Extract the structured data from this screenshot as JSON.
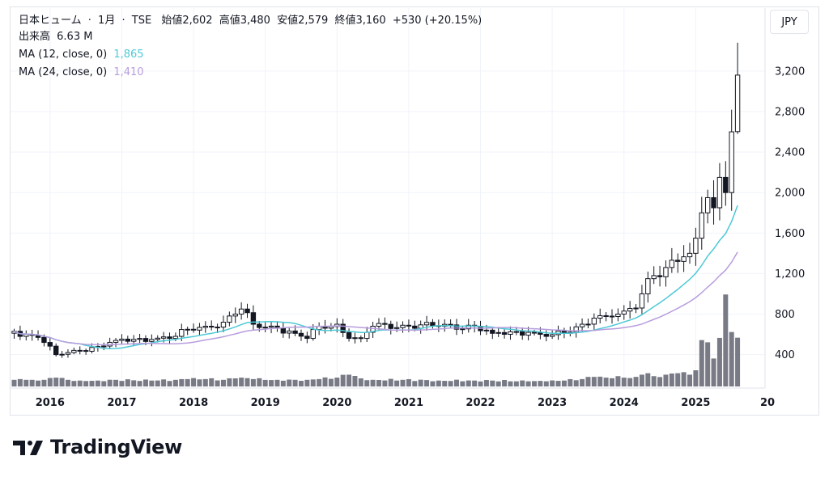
{
  "legend": {
    "name": "日本ヒューム",
    "interval": "1月",
    "exchange": "TSE",
    "sep": "·",
    "open_label": "始値",
    "open": "2,602",
    "high_label": "高値",
    "high": "3,480",
    "low_label": "安値",
    "low": "2,579",
    "close_label": "終値",
    "close": "3,160",
    "change": "+530 (+20.15%)",
    "volume_label": "出来高",
    "volume": "6.63 M",
    "ma12_label": "MA (12, close, 0)",
    "ma12_value": "1,865",
    "ma24_label": "MA (24, close, 0)",
    "ma24_value": "1,410"
  },
  "currency": "JPY",
  "brand": "TradingView",
  "colors": {
    "ma12": "#4ec9d6",
    "ma24": "#b79ddd",
    "candle": "#131722",
    "volume": "#787b86",
    "grid": "#f0f3fa"
  },
  "chart_data": {
    "type": "candlestick",
    "interval": "1M",
    "x_range": [
      "2015-07",
      "2025-09"
    ],
    "yticks": [
      "3,200",
      "2,800",
      "2,400",
      "2,000",
      "1,600",
      "1,200",
      "800",
      "400"
    ],
    "ylim": [
      0,
      3600
    ],
    "xticks": [
      "2016",
      "2017",
      "2018",
      "2019",
      "2020",
      "2021",
      "2022",
      "2023",
      "2024",
      "2025",
      "20"
    ],
    "keypoints": [
      {
        "t": "2015-07",
        "c": 630,
        "v": 0.9
      },
      {
        "t": "2015-08",
        "c": 580,
        "v": 1.0
      },
      {
        "t": "2015-09",
        "c": 600,
        "v": 0.9
      },
      {
        "t": "2015-10",
        "c": 590,
        "v": 0.9
      },
      {
        "t": "2015-11",
        "c": 570,
        "v": 0.8
      },
      {
        "t": "2015-12",
        "c": 520,
        "v": 0.9
      },
      {
        "t": "2016-02",
        "c": 400,
        "v": 1.2
      },
      {
        "t": "2016-04",
        "c": 420,
        "v": 0.9
      },
      {
        "t": "2016-06",
        "c": 440,
        "v": 0.8
      },
      {
        "t": "2016-09",
        "c": 480,
        "v": 0.8
      },
      {
        "t": "2016-12",
        "c": 540,
        "v": 0.9
      },
      {
        "t": "2017-06",
        "c": 550,
        "v": 0.8
      },
      {
        "t": "2017-10",
        "c": 580,
        "v": 0.9
      },
      {
        "t": "2017-12",
        "c": 650,
        "v": 1.0
      },
      {
        "t": "2018-03",
        "c": 680,
        "v": 1.0
      },
      {
        "t": "2018-06",
        "c": 720,
        "v": 0.9
      },
      {
        "t": "2018-08",
        "c": 800,
        "v": 1.1
      },
      {
        "t": "2018-09",
        "c": 850,
        "v": 1.2
      },
      {
        "t": "2018-11",
        "c": 700,
        "v": 1.0
      },
      {
        "t": "2019-03",
        "c": 660,
        "v": 0.9
      },
      {
        "t": "2019-06",
        "c": 610,
        "v": 0.9
      },
      {
        "t": "2019-08",
        "c": 560,
        "v": 0.9
      },
      {
        "t": "2019-10",
        "c": 680,
        "v": 1.0
      },
      {
        "t": "2020-01",
        "c": 700,
        "v": 1.2
      },
      {
        "t": "2020-03",
        "c": 560,
        "v": 1.6
      },
      {
        "t": "2020-05",
        "c": 560,
        "v": 1.1
      },
      {
        "t": "2020-07",
        "c": 680,
        "v": 0.9
      },
      {
        "t": "2020-12",
        "c": 690,
        "v": 0.9
      },
      {
        "t": "2021-06",
        "c": 680,
        "v": 0.8
      },
      {
        "t": "2021-12",
        "c": 680,
        "v": 0.8
      },
      {
        "t": "2022-03",
        "c": 610,
        "v": 0.8
      },
      {
        "t": "2022-09",
        "c": 620,
        "v": 0.7
      },
      {
        "t": "2022-12",
        "c": 580,
        "v": 0.7
      },
      {
        "t": "2023-03",
        "c": 610,
        "v": 0.8
      },
      {
        "t": "2023-06",
        "c": 700,
        "v": 1.0
      },
      {
        "t": "2023-08",
        "c": 760,
        "v": 1.3
      },
      {
        "t": "2023-10",
        "c": 780,
        "v": 1.2
      },
      {
        "t": "2023-12",
        "c": 800,
        "v": 1.4
      },
      {
        "t": "2024-01",
        "c": 830,
        "v": 1.2
      },
      {
        "t": "2024-03",
        "c": 860,
        "v": 1.3
      },
      {
        "t": "2024-04",
        "c": 1000,
        "v": 1.6
      },
      {
        "t": "2024-05",
        "c": 1150,
        "v": 1.8
      },
      {
        "t": "2024-06",
        "c": 1180,
        "v": 1.4
      },
      {
        "t": "2024-08",
        "c": 1260,
        "v": 1.6
      },
      {
        "t": "2024-10",
        "c": 1320,
        "v": 1.8
      },
      {
        "t": "2024-12",
        "c": 1400,
        "v": 1.6
      },
      {
        "t": "2025-01",
        "c": 1550,
        "v": 2.2
      },
      {
        "t": "2025-02",
        "c": 1800,
        "v": 6.3
      },
      {
        "t": "2025-03",
        "c": 1950,
        "v": 6.0
      },
      {
        "t": "2025-04",
        "c": 1850,
        "v": 3.8
      },
      {
        "t": "2025-05",
        "c": 2150,
        "v": 6.6
      },
      {
        "t": "2025-06",
        "c": 2000,
        "v": 12.5
      },
      {
        "t": "2025-07",
        "c": 2600,
        "v": 7.4
      },
      {
        "t": "2025-08",
        "c": 3160,
        "v": 6.63
      }
    ],
    "last": {
      "o": 2602,
      "h": 3480,
      "l": 2579,
      "c": 3160,
      "v": 6.63
    },
    "series": [
      {
        "name": "MA (12, close, 0)",
        "last": 1865
      },
      {
        "name": "MA (24, close, 0)",
        "last": 1410
      }
    ]
  }
}
